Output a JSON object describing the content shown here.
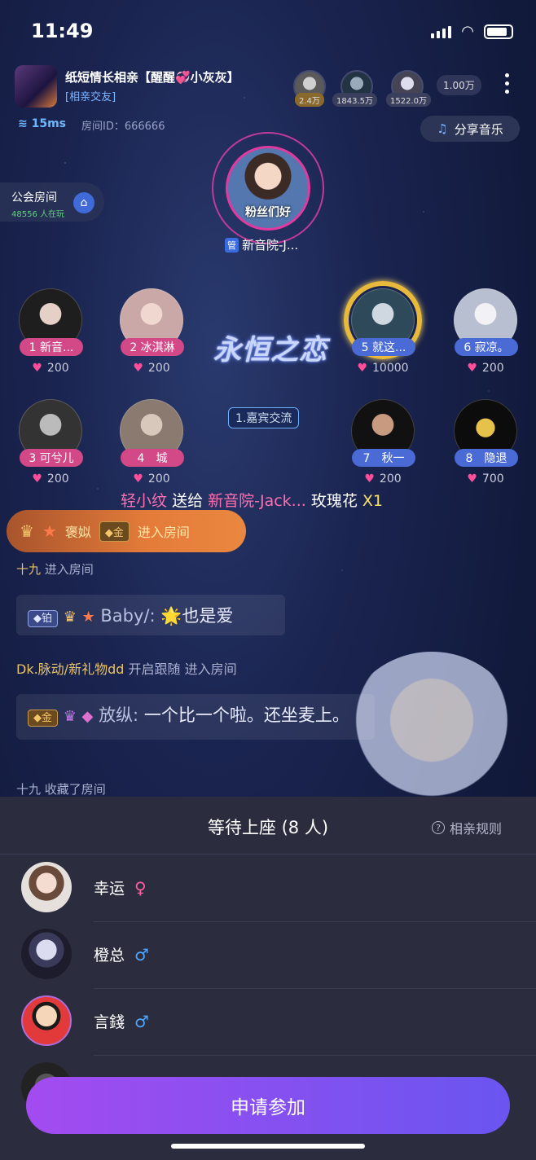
{
  "status_bar": {
    "time": "11:49"
  },
  "room": {
    "title": "纸短情长相亲【醒醒💞小灰灰】",
    "tag": "[相亲交友]",
    "ping": "15ms",
    "room_id": "房间ID：666666",
    "top_viewers": [
      {
        "count": "2.4万"
      },
      {
        "count": "1843.5万"
      },
      {
        "count": "1522.0万"
      }
    ],
    "fans_count": "1.00万",
    "share_music": "分享音乐"
  },
  "guild": {
    "title": "公会房间",
    "online": "48556 人在玩"
  },
  "host": {
    "caption": "粉丝们好",
    "admin_badge": "管",
    "name": "新音院-J..."
  },
  "seats": [
    {
      "label": "1 新音...",
      "hearts": "200",
      "gender": "female"
    },
    {
      "label": "2 冰淇淋",
      "hearts": "200",
      "gender": "female"
    },
    {
      "label": "5 就这...",
      "hearts": "10000",
      "gender": "male"
    },
    {
      "label": "6 寂凉。",
      "hearts": "200",
      "gender": "male"
    },
    {
      "label": "3 可兮儿",
      "hearts": "200",
      "gender": "female"
    },
    {
      "label": "4　城",
      "hearts": "200",
      "gender": "female"
    },
    {
      "label": "7　秋一",
      "hearts": "200",
      "gender": "male"
    },
    {
      "label": "8　隐退",
      "hearts": "700",
      "gender": "male"
    }
  ],
  "center_emblem": {
    "title": "永恒之恋",
    "subtitle": "1.嘉宾交流"
  },
  "gift": {
    "sender": "轻小纹",
    "verb": "送给",
    "receiver": "新音院-Jack...",
    "item": "玫瑰花",
    "count": "X1"
  },
  "enter_banner": {
    "name": "褒姒",
    "badge": "金",
    "text": "进入房间"
  },
  "chat": [
    {
      "type": "system",
      "name": "十九",
      "text": "进入房间"
    },
    {
      "type": "bubble",
      "badge": "铂",
      "name": "Baby/:",
      "text": "🌟也是爱"
    },
    {
      "type": "system",
      "name": "Dk.脉动/新礼物dd",
      "text": "开启跟随 进入房间"
    },
    {
      "type": "bubble",
      "badge": "金",
      "name": "放纵:",
      "text": "一个比一个啦。还坐麦上。"
    },
    {
      "type": "system",
      "name": "十九",
      "text": "收藏了房间"
    }
  ],
  "waiting": {
    "title": "等待上座 (8 人)",
    "rules": "相亲规则",
    "users": [
      {
        "name": "幸运",
        "gender_symbol": "♀",
        "gender": "f"
      },
      {
        "name": "橙总",
        "gender_symbol": "♂",
        "gender": "m"
      },
      {
        "name": "言錢",
        "gender_symbol": "♂",
        "gender": "m"
      }
    ]
  },
  "apply_button": "申请参加",
  "colors": {
    "accent_purple": "#a34bf0",
    "accent_pink": "#d34887",
    "accent_blue": "#4a6ad6"
  }
}
